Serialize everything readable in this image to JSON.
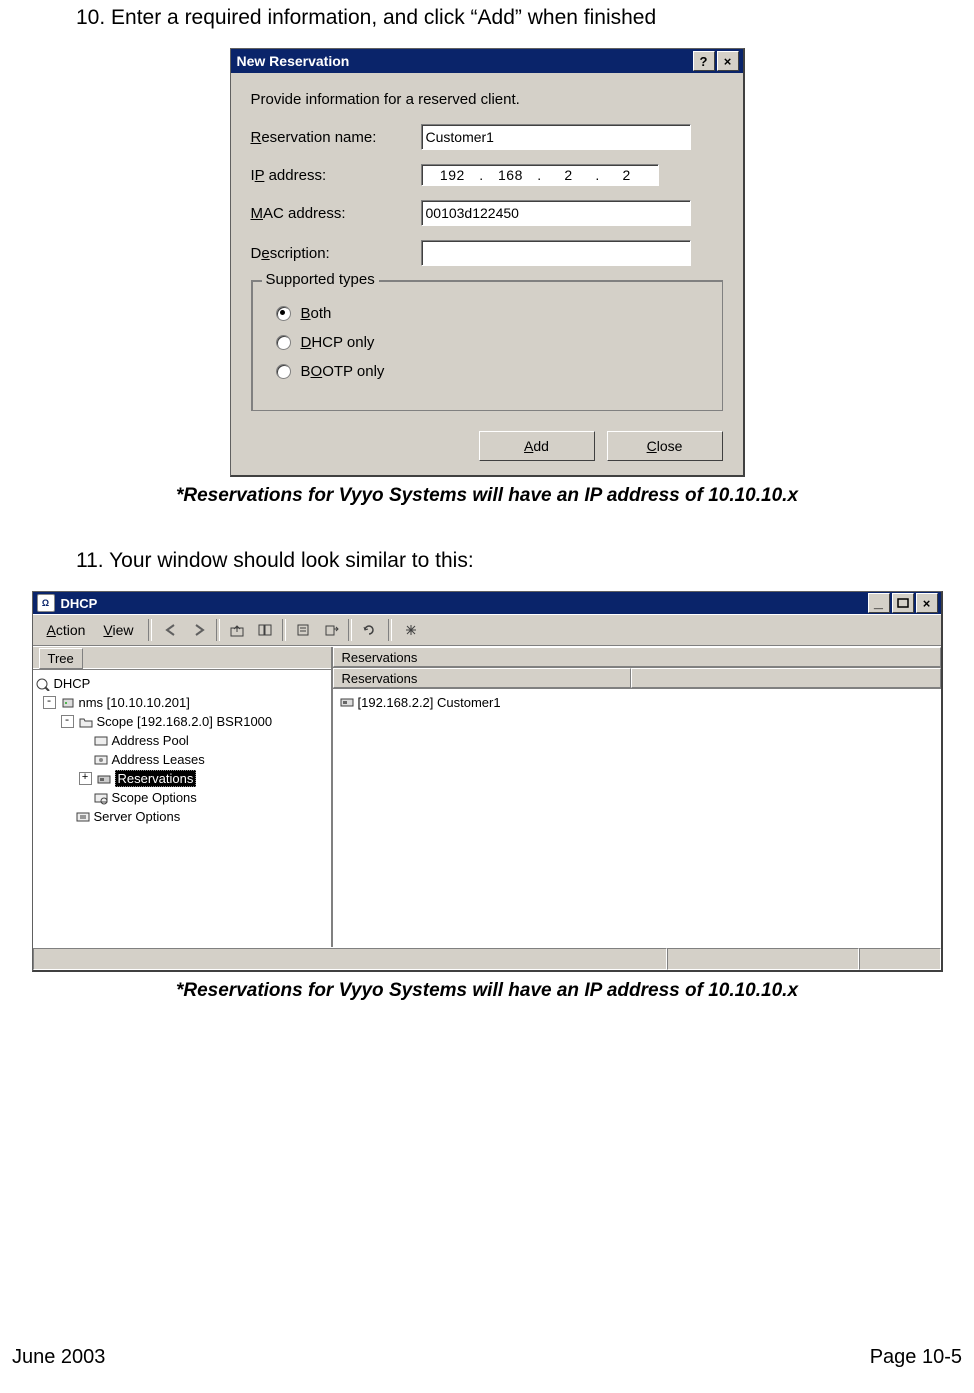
{
  "step10": "10. Enter a required information, and click “Add” when finished",
  "note1": "*Reservations for Vyyo Systems will have an IP address of 10.10.10.x",
  "step11": "11. Your window should look similar to this:",
  "note2": "*Reservations for Vyyo Systems will have an IP address of 10.10.10.x",
  "footer_left": "June 2003",
  "footer_right": "Page 10-5",
  "dialog": {
    "title": "New Reservation",
    "caption": "Provide information for a reserved client.",
    "labels": {
      "res_name": "Reservation name:",
      "ip": "IP address:",
      "mac": "MAC address:",
      "desc": "Description:",
      "legend": "Supported types"
    },
    "values": {
      "res_name": "Customer1",
      "ip_o1": "192",
      "ip_o2": "168",
      "ip_o3": "2",
      "ip_o4": "2",
      "mac": "00103d122450",
      "desc": ""
    },
    "radios": {
      "both": "Both",
      "dhcp": "DHCP only",
      "bootp": "BOOTP only"
    },
    "buttons": {
      "add": "Add",
      "close": "Close"
    }
  },
  "mmc": {
    "title": "DHCP",
    "menu": {
      "action": "Action",
      "view": "View"
    },
    "tree_tab": "Tree",
    "tree": {
      "root": "DHCP",
      "nms": "nms [10.10.10.201]",
      "scope": "Scope [192.168.2.0] BSR1000",
      "addr_pool": "Address Pool",
      "addr_leases": "Address Leases",
      "reservations": "Reservations",
      "scope_opts": "Scope Options",
      "server_opts": "Server Options"
    },
    "list": {
      "header": "Reservations",
      "col1": "Reservations",
      "row1": "[192.168.2.2] Customer1"
    }
  }
}
